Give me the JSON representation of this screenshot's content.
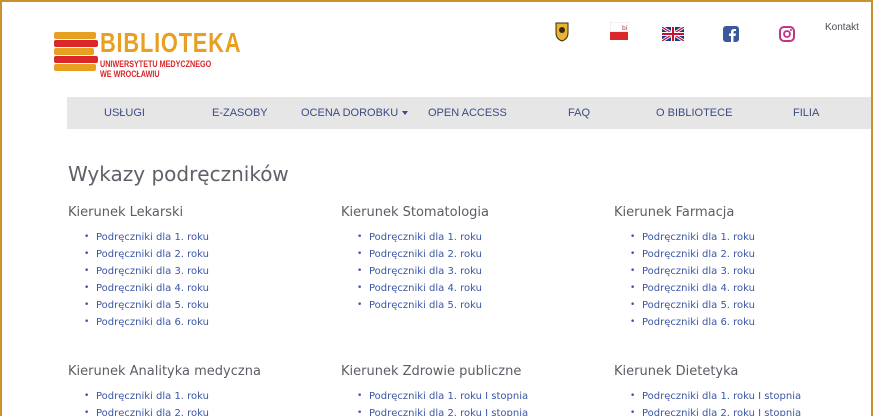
{
  "logo": {
    "title": "BIBLIOTEKA",
    "sub_line1": "UNIWERSYTETU MEDYCZNEGO",
    "sub_line2": "WE WROCŁAWIU",
    "colors": {
      "orange": "#e8a023",
      "red": "#d9272a"
    }
  },
  "top_bar": {
    "icons": [
      "crest-icon",
      "bip-icon",
      "uk-flag-icon",
      "facebook-icon",
      "instagram-icon"
    ],
    "bip_label": "bip",
    "kontakt": "Kontakt"
  },
  "nav": {
    "items": [
      {
        "label": "USŁUGI"
      },
      {
        "label": "E-ZASOBY"
      },
      {
        "label": "OCENA DOROBKU",
        "has_dropdown": true
      },
      {
        "label": "OPEN ACCESS"
      },
      {
        "label": "FAQ"
      },
      {
        "label": "O BIBLIOTECE"
      },
      {
        "label": "FILIA"
      }
    ]
  },
  "main": {
    "title": "Wykazy podręczników",
    "sections": [
      {
        "heading": "Kierunek Lekarski",
        "links": [
          "Podręczniki dla 1. roku",
          "Podręczniki dla 2. roku",
          "Podręczniki dla 3. roku",
          "Podręczniki dla 4. roku",
          "Podręczniki dla 5. roku",
          "Podręczniki dla 6. roku"
        ]
      },
      {
        "heading": "Kierunek Stomatologia",
        "links": [
          "Podręczniki dla 1. roku",
          "Podręczniki dla 2. roku",
          "Podręczniki dla 3. roku",
          "Podręczniki dla 4. roku",
          "Podręczniki dla 5. roku"
        ]
      },
      {
        "heading": "Kierunek Farmacja",
        "links": [
          "Podręczniki dla 1. roku",
          "Podręczniki dla 2. roku",
          "Podręczniki dla 3. roku",
          "Podręczniki dla 4. roku",
          "Podręczniki dla 5. roku",
          "Podręczniki dla 6. roku"
        ]
      },
      {
        "heading": "Kierunek Analityka medyczna",
        "links": [
          "Podręczniki dla 1. roku",
          "Podręczniki dla 2. roku"
        ]
      },
      {
        "heading": "Kierunek Zdrowie publiczne",
        "links": [
          "Podręczniki dla 1. roku I stopnia",
          "Podręczniki dla 2. roku I stopnia"
        ]
      },
      {
        "heading": "Kierunek Dietetyka",
        "links": [
          "Podręczniki dla 1. roku I stopnia",
          "Podręczniki dla 2. roku I stopnia"
        ]
      }
    ]
  }
}
